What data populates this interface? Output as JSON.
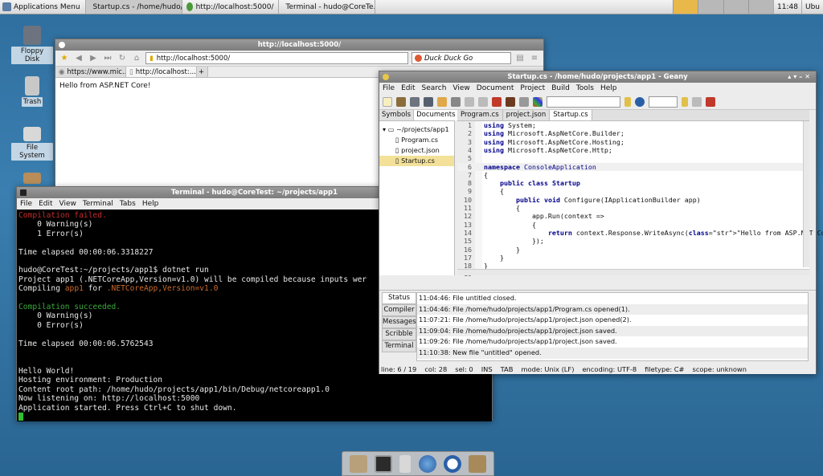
{
  "panel": {
    "menu_label": "Applications Menu",
    "tasks": [
      {
        "label": "Startup.cs - /home/hudo/..."
      },
      {
        "label": "http://localhost:5000/"
      },
      {
        "label": "Terminal - hudo@CoreTe..."
      }
    ],
    "clock": "11:48",
    "user": "Ubu"
  },
  "desktop": {
    "icons": [
      {
        "label": "Floppy Disk"
      },
      {
        "label": "Trash"
      },
      {
        "label": "File System"
      }
    ]
  },
  "browser": {
    "title": "http://localhost:5000/",
    "url": "http://localhost:5000/",
    "search_engine": "Duck Duck Go",
    "tabs": [
      {
        "label": "https://www.mic..."
      },
      {
        "label": "http://localhost:..."
      }
    ],
    "content": "Hello from ASP.NET Core!"
  },
  "terminal": {
    "title": "Terminal - hudo@CoreTest: ~/projects/app1",
    "menu": [
      "File",
      "Edit",
      "View",
      "Terminal",
      "Tabs",
      "Help"
    ],
    "lines": {
      "l1": "Compilation failed.",
      "l2": "    0 Warning(s)",
      "l3": "    1 Error(s)",
      "l5": "Time elapsed 00:00:06.3318227",
      "l7": "hudo@CoreTest:~/projects/app1$ dotnet run",
      "l8": "Project app1 (.NETCoreApp,Version=v1.0) will be compiled because inputs wer",
      "l9a": "Compiling ",
      "l9b": "app1",
      "l9c": " for ",
      "l9d": ".NETCoreApp,Version=v1.0",
      "l11": "Compilation succeeded.",
      "l12": "    0 Warning(s)",
      "l13": "    0 Error(s)",
      "l15": "Time elapsed 00:00:06.5762543",
      "l18": "Hello World!",
      "l19": "Hosting environment: Production",
      "l20": "Content root path: /home/hudo/projects/app1/bin/Debug/netcoreapp1.0",
      "l21": "Now listening on: http://localhost:5000",
      "l22": "Application started. Press Ctrl+C to shut down."
    }
  },
  "geany": {
    "title": "Startup.cs - /home/hudo/projects/app1 - Geany",
    "menu": [
      "File",
      "Edit",
      "Search",
      "View",
      "Document",
      "Project",
      "Build",
      "Tools",
      "Help"
    ],
    "sidebar_tabs": [
      "Symbols",
      "Documents"
    ],
    "tree": {
      "root": "~/projects/app1",
      "files": [
        "Program.cs",
        "project.json",
        "Startup.cs"
      ]
    },
    "editor_tabs": [
      "Program.cs",
      "project.json",
      "Startup.cs"
    ],
    "code": [
      "using System;",
      "using Microsoft.AspNetCore.Builder;",
      "using Microsoft.AspNetCore.Hosting;",
      "using Microsoft.AspNetCore.Http;",
      "",
      "namespace ConsoleApplication",
      "{",
      "    public class Startup",
      "    {",
      "        public void Configure(IApplicationBuilder app)",
      "        {",
      "            app.Run(context =>",
      "            {",
      "                return context.Response.WriteAsync(\"Hello from ASP.NET Core!\");",
      "            });",
      "        }",
      "    }",
      "}",
      ""
    ],
    "message_tabs": [
      "Status",
      "Compiler",
      "Messages",
      "Scribble",
      "Terminal"
    ],
    "messages": [
      "11:04:46: File untitled closed.",
      "11:04:46: File /home/hudo/projects/app1/Program.cs opened(1).",
      "11:07:21: File /home/hudo/projects/app1/project.json opened(2).",
      "11:09:04: File /home/hudo/projects/app1/project.json saved.",
      "11:09:26: File /home/hudo/projects/app1/project.json saved.",
      "11:10:38: New file \"untitled\" opened."
    ],
    "status": {
      "line": "line: 6 / 19",
      "col": "col: 28",
      "sel": "sel: 0",
      "ins": "INS",
      "tab": "TAB",
      "mode": "mode: Unix (LF)",
      "encoding": "encoding: UTF-8",
      "filetype": "filetype: C#",
      "scope": "scope: unknown"
    }
  }
}
